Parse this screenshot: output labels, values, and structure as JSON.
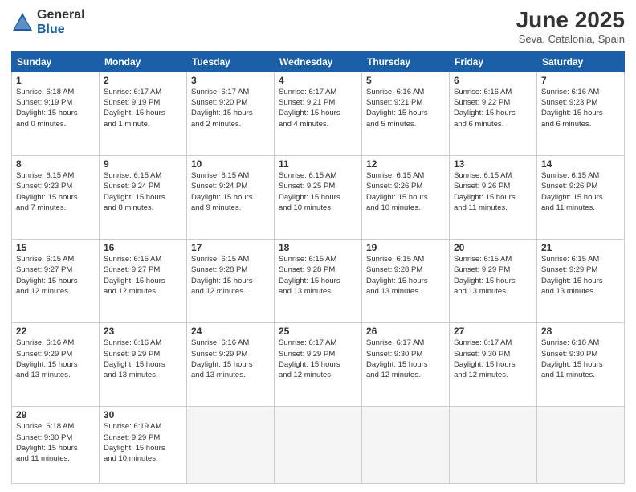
{
  "logo": {
    "general": "General",
    "blue": "Blue"
  },
  "title": "June 2025",
  "location": "Seva, Catalonia, Spain",
  "weekdays": [
    "Sunday",
    "Monday",
    "Tuesday",
    "Wednesday",
    "Thursday",
    "Friday",
    "Saturday"
  ],
  "weeks": [
    [
      {
        "day": "1",
        "info": "Sunrise: 6:18 AM\nSunset: 9:19 PM\nDaylight: 15 hours\nand 0 minutes."
      },
      {
        "day": "2",
        "info": "Sunrise: 6:17 AM\nSunset: 9:19 PM\nDaylight: 15 hours\nand 1 minute."
      },
      {
        "day": "3",
        "info": "Sunrise: 6:17 AM\nSunset: 9:20 PM\nDaylight: 15 hours\nand 2 minutes."
      },
      {
        "day": "4",
        "info": "Sunrise: 6:17 AM\nSunset: 9:21 PM\nDaylight: 15 hours\nand 4 minutes."
      },
      {
        "day": "5",
        "info": "Sunrise: 6:16 AM\nSunset: 9:21 PM\nDaylight: 15 hours\nand 5 minutes."
      },
      {
        "day": "6",
        "info": "Sunrise: 6:16 AM\nSunset: 9:22 PM\nDaylight: 15 hours\nand 6 minutes."
      },
      {
        "day": "7",
        "info": "Sunrise: 6:16 AM\nSunset: 9:23 PM\nDaylight: 15 hours\nand 6 minutes."
      }
    ],
    [
      {
        "day": "8",
        "info": "Sunrise: 6:15 AM\nSunset: 9:23 PM\nDaylight: 15 hours\nand 7 minutes."
      },
      {
        "day": "9",
        "info": "Sunrise: 6:15 AM\nSunset: 9:24 PM\nDaylight: 15 hours\nand 8 minutes."
      },
      {
        "day": "10",
        "info": "Sunrise: 6:15 AM\nSunset: 9:24 PM\nDaylight: 15 hours\nand 9 minutes."
      },
      {
        "day": "11",
        "info": "Sunrise: 6:15 AM\nSunset: 9:25 PM\nDaylight: 15 hours\nand 10 minutes."
      },
      {
        "day": "12",
        "info": "Sunrise: 6:15 AM\nSunset: 9:26 PM\nDaylight: 15 hours\nand 10 minutes."
      },
      {
        "day": "13",
        "info": "Sunrise: 6:15 AM\nSunset: 9:26 PM\nDaylight: 15 hours\nand 11 minutes."
      },
      {
        "day": "14",
        "info": "Sunrise: 6:15 AM\nSunset: 9:26 PM\nDaylight: 15 hours\nand 11 minutes."
      }
    ],
    [
      {
        "day": "15",
        "info": "Sunrise: 6:15 AM\nSunset: 9:27 PM\nDaylight: 15 hours\nand 12 minutes."
      },
      {
        "day": "16",
        "info": "Sunrise: 6:15 AM\nSunset: 9:27 PM\nDaylight: 15 hours\nand 12 minutes."
      },
      {
        "day": "17",
        "info": "Sunrise: 6:15 AM\nSunset: 9:28 PM\nDaylight: 15 hours\nand 12 minutes."
      },
      {
        "day": "18",
        "info": "Sunrise: 6:15 AM\nSunset: 9:28 PM\nDaylight: 15 hours\nand 13 minutes."
      },
      {
        "day": "19",
        "info": "Sunrise: 6:15 AM\nSunset: 9:28 PM\nDaylight: 15 hours\nand 13 minutes."
      },
      {
        "day": "20",
        "info": "Sunrise: 6:15 AM\nSunset: 9:29 PM\nDaylight: 15 hours\nand 13 minutes."
      },
      {
        "day": "21",
        "info": "Sunrise: 6:15 AM\nSunset: 9:29 PM\nDaylight: 15 hours\nand 13 minutes."
      }
    ],
    [
      {
        "day": "22",
        "info": "Sunrise: 6:16 AM\nSunset: 9:29 PM\nDaylight: 15 hours\nand 13 minutes."
      },
      {
        "day": "23",
        "info": "Sunrise: 6:16 AM\nSunset: 9:29 PM\nDaylight: 15 hours\nand 13 minutes."
      },
      {
        "day": "24",
        "info": "Sunrise: 6:16 AM\nSunset: 9:29 PM\nDaylight: 15 hours\nand 13 minutes."
      },
      {
        "day": "25",
        "info": "Sunrise: 6:17 AM\nSunset: 9:29 PM\nDaylight: 15 hours\nand 12 minutes."
      },
      {
        "day": "26",
        "info": "Sunrise: 6:17 AM\nSunset: 9:30 PM\nDaylight: 15 hours\nand 12 minutes."
      },
      {
        "day": "27",
        "info": "Sunrise: 6:17 AM\nSunset: 9:30 PM\nDaylight: 15 hours\nand 12 minutes."
      },
      {
        "day": "28",
        "info": "Sunrise: 6:18 AM\nSunset: 9:30 PM\nDaylight: 15 hours\nand 11 minutes."
      }
    ],
    [
      {
        "day": "29",
        "info": "Sunrise: 6:18 AM\nSunset: 9:30 PM\nDaylight: 15 hours\nand 11 minutes."
      },
      {
        "day": "30",
        "info": "Sunrise: 6:19 AM\nSunset: 9:29 PM\nDaylight: 15 hours\nand 10 minutes."
      },
      {
        "day": "",
        "info": ""
      },
      {
        "day": "",
        "info": ""
      },
      {
        "day": "",
        "info": ""
      },
      {
        "day": "",
        "info": ""
      },
      {
        "day": "",
        "info": ""
      }
    ]
  ]
}
